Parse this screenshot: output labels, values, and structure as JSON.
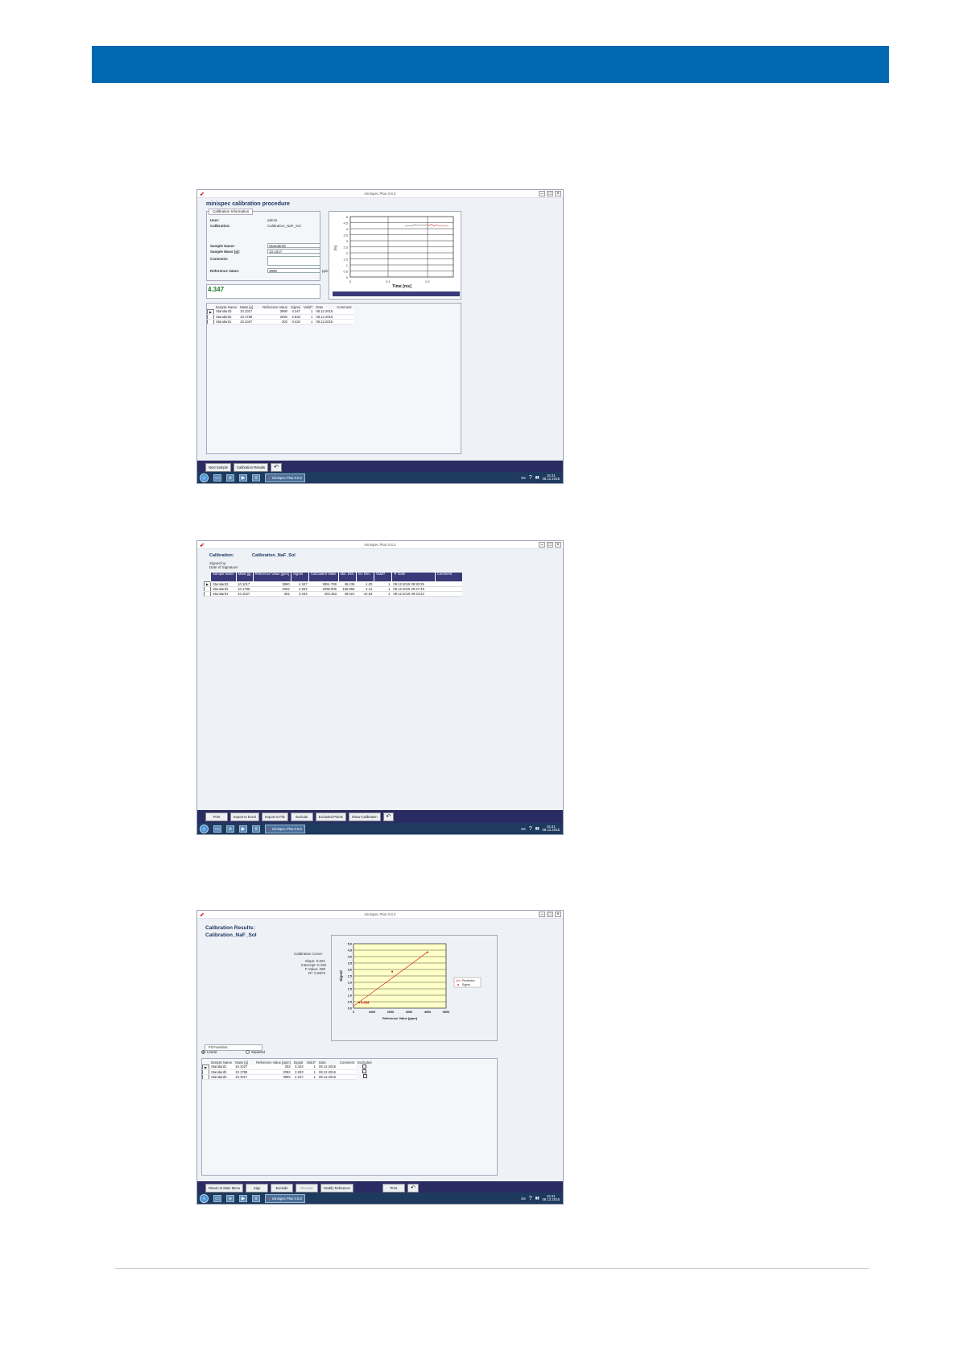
{
  "window": {
    "title": "minispec Plus 0.8.2"
  },
  "taskbar": {
    "task_label": "minispec Plus 0.8.2",
    "tray_lang": "De",
    "clock_time": "15:31",
    "clock_date": "08.12.2015"
  },
  "shot1": {
    "heading": "minispec calibration procedure",
    "info_tab": "Calibration Information",
    "user_label": "User:",
    "user_value": "admin",
    "calibration_label": "Calibration:",
    "calibration_value": "Calibration_NaF_Sol",
    "sample_name_label": "Sample Name:",
    "sample_name_value": "Standard3",
    "sample_mass_label": "Sample Mass [g]:",
    "sample_mass_value": "10.1017",
    "comment_label": "Comment:",
    "comment_value": "",
    "reference_label": "Reference Value:",
    "reference_value": "3990",
    "reference_unit": "ppm",
    "big_value": "4.347",
    "chart": {
      "x_label": "Time [ms]",
      "y_label": "[%]",
      "y_ticks": [
        "5",
        "4.5",
        "4",
        "3.5",
        "3",
        "2.5",
        "2",
        "1.5",
        "1",
        "0.5",
        "0"
      ],
      "x_ticks": [
        "0",
        "0.1",
        "0.2"
      ]
    },
    "table": {
      "headers": [
        "Sample Name",
        "Mass [g]",
        "Reference Value",
        "Signal",
        "Valid?",
        "Date",
        "Comment"
      ],
      "rows": [
        [
          "Standard3",
          "10.1017",
          "3990",
          "4.347",
          "1",
          "08.12.2015",
          ""
        ],
        [
          "Standard2",
          "10.1785",
          "2092",
          "2.833",
          "1",
          "08.12.2015",
          ""
        ],
        [
          "Standard1",
          "10.1027",
          "302",
          "0.434",
          "1",
          "08.12.2015",
          ""
        ]
      ]
    },
    "buttons": {
      "next": "Next Sample",
      "results": "Calibration Results",
      "undo": "↶"
    }
  },
  "shot2": {
    "calibration_label": "Calibration:",
    "calibration_value": "Calibration_NaF_Sol",
    "signed_by": "Signed by:",
    "date_of_signature": "Date of Signature:",
    "table": {
      "headers": [
        "Sample Name",
        "Mass [g]",
        "Reference Value [ppm]",
        "Signal",
        "Calculated Value",
        "abs. Dev.",
        "rel. Dev.",
        "Valid?",
        "▼ Date",
        "Comment"
      ],
      "rows": [
        [
          "Standard3",
          "10.1017",
          "3990",
          "4.347",
          "3951.769",
          "49.235",
          "-1.00",
          "1",
          "08.12.2015 09:30:29",
          ""
        ],
        [
          "Standard2",
          "10.1785",
          "2092",
          "2.833",
          "2096.905",
          "169.965",
          "4.12",
          "1",
          "08.12.2015 09:27:49",
          ""
        ],
        [
          "Standard1",
          "10.1027",
          "302",
          "0.434",
          "250.353",
          "49.021",
          "-12.54",
          "1",
          "08.12.2015 09:23:43",
          ""
        ]
      ]
    },
    "buttons": {
      "print": "Print",
      "excel": "Export to Excel",
      "file": "Export to File",
      "exclude": "Exclude",
      "excluded": "Excluded Points",
      "show": "Show Calibration",
      "undo": "↶"
    }
  },
  "shot3": {
    "heading1": "Calibration Results:",
    "heading2": "Calibration_NaF_Sol",
    "curve_title": "Calibration Curve:",
    "slope": "Slope: 0.001",
    "intercept": "Intercept: 0.152",
    "fvalue": "F-Value: 299",
    "r2": "R²: 0.9973",
    "fit_tab": "Fit Function",
    "radio_linear": "Linear",
    "radio_squared": "Squared",
    "legend": {
      "prediction": "Prediction",
      "signal": "Signal"
    },
    "point_label": "0.434",
    "table": {
      "headers": [
        "Sample Name",
        "Mass [g]",
        "Reference Value [ppm]",
        "Signal",
        "Valid?",
        "Date",
        "Comment",
        "Excluded"
      ],
      "rows": [
        [
          "Standard1",
          "10.1027",
          "302",
          "0.434",
          "1",
          "08.12.2015",
          ""
        ],
        [
          "Standard2",
          "10.1785",
          "2092",
          "2.833",
          "1",
          "08.12.2015",
          ""
        ],
        [
          "Standard3",
          "10.1017",
          "3990",
          "4.347",
          "1",
          "08.12.2015",
          ""
        ]
      ]
    },
    "buttons": {
      "main": "Return to Main Menu",
      "sign": "Sign",
      "exclude": "Exclude",
      "recover": "Recover",
      "modify": "Modify Reference",
      "print": "Print",
      "undo": "↶"
    }
  },
  "chart_data": {
    "type": "scatter",
    "x": [
      302,
      2092,
      3990
    ],
    "y": [
      0.434,
      2.833,
      4.347
    ],
    "series": [
      {
        "name": "Signal",
        "x": [
          302,
          2092,
          3990
        ],
        "y": [
          0.434,
          2.833,
          4.347
        ]
      },
      {
        "name": "Prediction",
        "x": [
          0,
          4000
        ],
        "y": [
          0.152,
          4.35
        ]
      }
    ],
    "xlabel": "Reference Value [ppm]",
    "ylabel": "Signal",
    "xlim": [
      0,
      5000
    ],
    "ylim": [
      0,
      5
    ],
    "x_ticks": [
      "0",
      "1000",
      "2000",
      "3000",
      "4000",
      "5000"
    ],
    "y_ticks": [
      "5.0",
      "4.5",
      "4.0",
      "3.5",
      "3.0",
      "2.5",
      "2.0",
      "1.5",
      "1.0",
      "0.5",
      "0.0"
    ],
    "grid": true,
    "legend": "right",
    "colors": {
      "background": "#ffffc8",
      "signal": "#cc0000",
      "prediction": "#cc0000"
    }
  }
}
